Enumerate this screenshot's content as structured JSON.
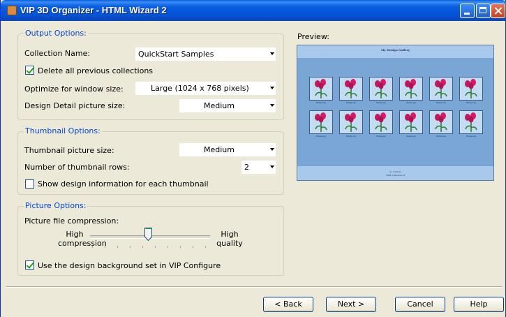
{
  "window": {
    "title": "VIP 3D Organizer - HTML Wizard 2"
  },
  "output_options": {
    "legend": "Output Options:",
    "collection_name_label": "Collection Name:",
    "collection_name_value": "QuickStart Samples",
    "delete_label": "Delete all previous collections",
    "delete_checked": true,
    "optimize_label": "Optimize for window size:",
    "optimize_value": "Large (1024 x 768 pixels)",
    "detail_size_label": "Design Detail picture size:",
    "detail_size_value": "Medium"
  },
  "thumbnail_options": {
    "legend": "Thumbnail Options:",
    "thumb_size_label": "Thumbnail picture size:",
    "thumb_size_value": "Medium",
    "rows_label": "Number of thumbnail rows:",
    "rows_value": "2",
    "show_info_label": "Show design information for each thumbnail",
    "show_info_checked": false
  },
  "picture_options": {
    "legend": "Picture Options:",
    "compression_label": "Picture file compression:",
    "high_compression_label": "High\ncompression",
    "high_quality_label": "High\nquality",
    "compression_level_fraction": 0.5,
    "bg_label": "Use the design background set in VIP Configure",
    "bg_checked": true
  },
  "preview": {
    "label": "Preview:",
    "gallery_title": "My Design Gallery",
    "thumb_caption": "Tulips.vip",
    "footer_line1": "1 (1 Items)",
    "footer_line2": "VISM Software Ltd",
    "rows": 2,
    "cols": 6
  },
  "buttons": {
    "back": "< Back",
    "next": "Next >",
    "cancel": "Cancel",
    "help": "Help"
  },
  "colors": {
    "title_bar": "#0a5fdc",
    "legend_text": "#0046d5",
    "preview_bg": "#7aa6d6",
    "check": "#21a121"
  },
  "icons": {
    "app": "vip-app-icon",
    "minimize": "minimize-icon",
    "maximize": "maximize-icon",
    "close": "close-icon"
  }
}
